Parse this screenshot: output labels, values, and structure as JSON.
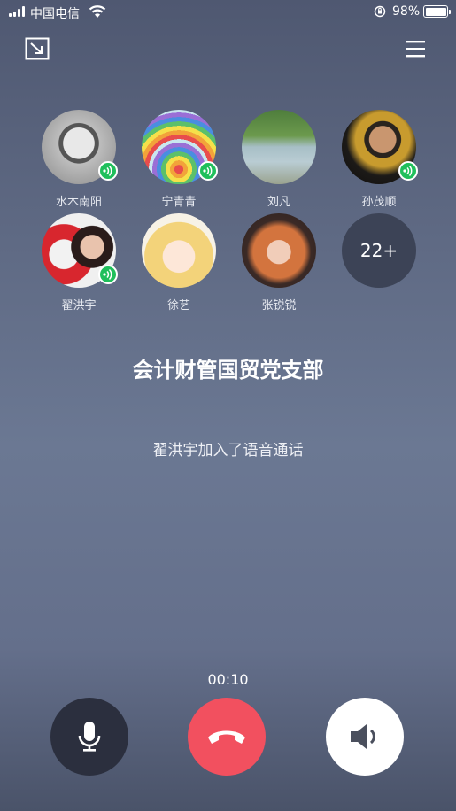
{
  "status_bar": {
    "carrier": "中国电信",
    "battery": "98%",
    "icons": [
      "signal-icon",
      "wifi-icon",
      "rotation-lock-icon",
      "battery-icon"
    ]
  },
  "header": {
    "minimize_icon": "minimize-icon",
    "menu_icon": "menu-icon"
  },
  "participants": [
    {
      "name": "水木南阳",
      "speaking": true
    },
    {
      "name": "宁青青",
      "speaking": true
    },
    {
      "name": "刘凡",
      "speaking": false
    },
    {
      "name": "孙茂顺",
      "speaking": true
    },
    {
      "name": "翟洪宇",
      "speaking": true
    },
    {
      "name": "徐艺",
      "speaking": false
    },
    {
      "name": "张锐锐",
      "speaking": false
    }
  ],
  "more_count": "22+",
  "group_name": "会计财管国贸党支部",
  "notice": "翟洪宇加入了语音通话",
  "call_timer": "00:10",
  "controls": {
    "mute_icon": "microphone-icon",
    "hangup_icon": "hang-up-icon",
    "speaker_icon": "speaker-icon"
  },
  "colors": {
    "hangup": "#f2505f",
    "speaking_badge": "#1fbf5b",
    "mute_bg": "#2b2f3e"
  }
}
